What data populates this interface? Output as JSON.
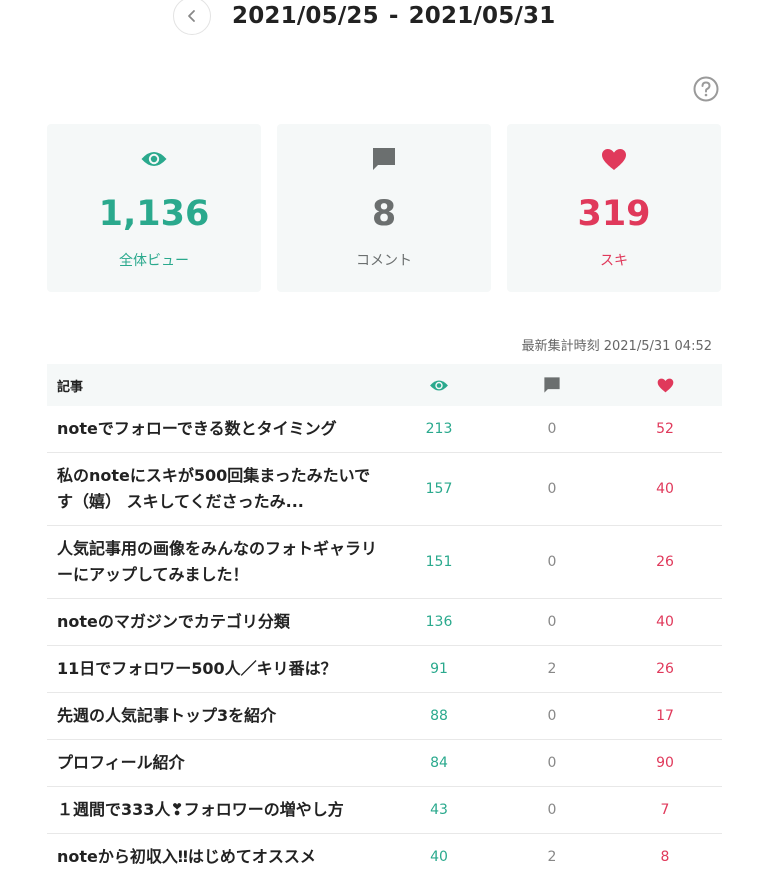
{
  "header": {
    "start_date": "2021/05/25",
    "separator": "-",
    "end_date": "2021/05/31"
  },
  "summary": {
    "views": {
      "value": "1,136",
      "label": "全体ビュー",
      "icon": "eye-icon",
      "color": "#2aa98d"
    },
    "comments": {
      "value": "8",
      "label": "コメント",
      "icon": "comment-icon",
      "color": "#6b6f6f"
    },
    "likes": {
      "value": "319",
      "label": "スキ",
      "icon": "heart-icon",
      "color": "#e0395b"
    }
  },
  "updated_at": "最新集計時刻 2021/5/31 04:52",
  "table": {
    "header_title": "記事",
    "rows": [
      {
        "title": "noteでフォローできる数とタイミング",
        "views": "213",
        "comments": "0",
        "likes": "52"
      },
      {
        "title": "私のnoteにスキが500回集まったみたいです（嬉） スキしてくださったみ...",
        "views": "157",
        "comments": "0",
        "likes": "40"
      },
      {
        "title": "人気記事用の画像をみんなのフォトギャラリーにアップしてみました！",
        "views": "151",
        "comments": "0",
        "likes": "26"
      },
      {
        "title": "noteのマガジンでカテゴリ分類",
        "views": "136",
        "comments": "0",
        "likes": "40"
      },
      {
        "title": "11日でフォロワー500人／キリ番は？",
        "views": "91",
        "comments": "2",
        "likes": "26"
      },
      {
        "title": "先週の人気記事トップ3を紹介",
        "views": "88",
        "comments": "0",
        "likes": "17"
      },
      {
        "title": "プロフィール紹介",
        "views": "84",
        "comments": "0",
        "likes": "90"
      },
      {
        "title": "１週間で333人❣フォロワーの増やし方",
        "views": "43",
        "comments": "0",
        "likes": "7"
      },
      {
        "title": "noteから初収入‼はじめてオススメ",
        "views": "40",
        "comments": "2",
        "likes": "8"
      }
    ]
  }
}
